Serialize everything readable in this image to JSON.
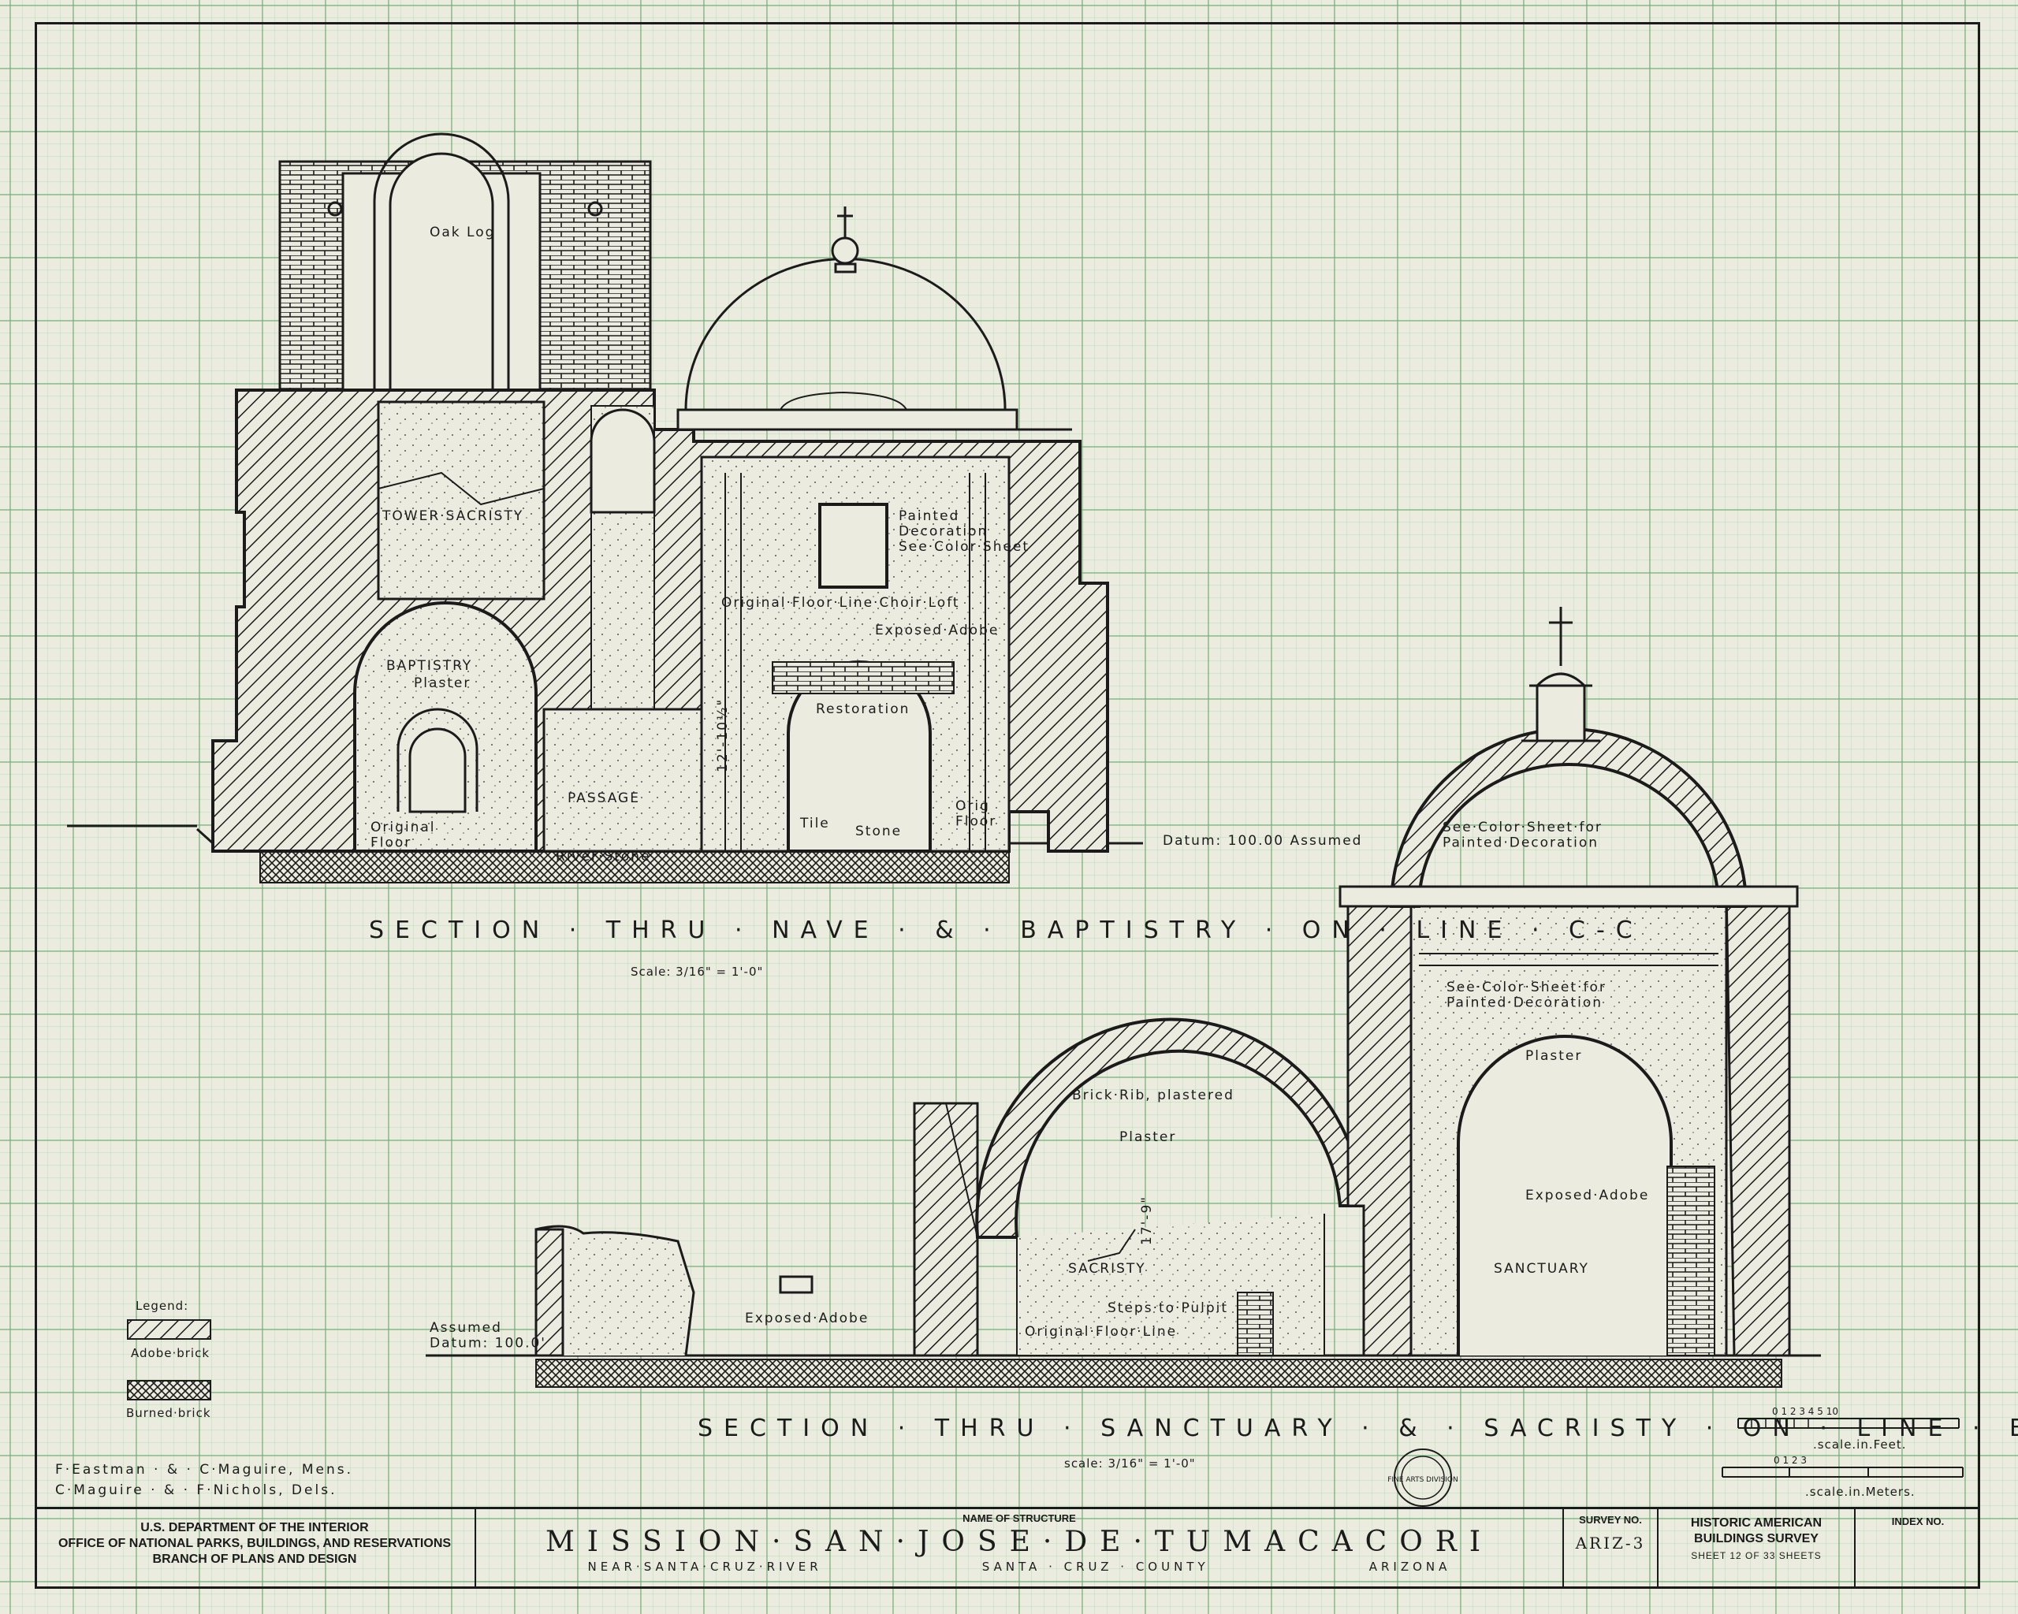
{
  "drawing": {
    "section_cc": {
      "title": "SECTION · THRU · NAVE · & · BAPTISTRY · ON · LINE · C-C",
      "scale": "Scale: 3/16\" = 1'-0\"",
      "labels": {
        "oak_log": "Oak Log",
        "tower_sacristy": "TOWER·SACRISTY",
        "painted_decoration": "Painted\nDecoration\nSee·Color·Sheet",
        "choir_loft": "Original·Floor·Line·Choir·Loft",
        "exposed_adobe": "Exposed·Adobe",
        "baptistry": "BAPTISTRY",
        "plaster": "Plaster",
        "restoration": "Restoration",
        "passage": "PASSAGE",
        "original_floor": "Original\nFloor",
        "dimension": "12'-10½\"",
        "tile": "Tile",
        "stone": "Stone",
        "orig_floor": "Orig\nFloor",
        "river_stone": "River·Stone",
        "datum": "Datum: 100.00 Assumed"
      }
    },
    "section_bb": {
      "title": "SECTION · THRU · SANCTUARY · & · SACRISTY · ON · LINE · B-B",
      "scale": "scale: 3/16\" = 1'-0\"",
      "labels": {
        "see_color_1": "See·Color·Sheet·for\nPainted·Decoration",
        "see_color_2": "See·Color·Sheet·for\nPainted·Decoration",
        "plaster_sanct": "Plaster",
        "brick_rib": "Brick·Rib, plastered",
        "plaster_sac": "Plaster",
        "dimension": "17'-9\"",
        "sacristy": "SACRISTY",
        "exposed_adobe_sanct": "Exposed·Adobe",
        "sanctuary": "SANCTUARY",
        "steps_to_pulpit": "Steps·to·Pulpit",
        "original_floor_line": "Original·Floor·Line",
        "exposed_adobe_left": "Exposed·Adobe",
        "assumed_datum": "Assumed\nDatum: 100.0'"
      }
    }
  },
  "legend": {
    "title": "Legend:",
    "items": [
      {
        "label": "Adobe·brick",
        "pattern": "hatch"
      },
      {
        "label": "Burned·brick",
        "pattern": "crosshatch"
      }
    ]
  },
  "scales": {
    "feet_ticks": [
      "0",
      "1",
      "2",
      "3",
      "4",
      "5",
      "10"
    ],
    "feet_label": ".scale.in.Feet.",
    "meters_ticks": [
      "0",
      "1",
      "2",
      "3"
    ],
    "meters_label": ".scale.in.Meters."
  },
  "stamp": "FINE ARTS DIVISION",
  "credits": [
    "F·Eastman · & · C·Maguire, Mens.",
    "C·Maguire · & · F·Nichols, Dels."
  ],
  "title_block": {
    "agency": [
      "U.S. DEPARTMENT OF THE INTERIOR",
      "OFFICE OF NATIONAL PARKS, BUILDINGS, AND RESERVATIONS",
      "BRANCH OF PLANS AND DESIGN"
    ],
    "name_caption": "NAME OF STRUCTURE",
    "structure_name": "MISSION·SAN·JOSE·DE·TUMACACORI",
    "location": [
      "NEAR·SANTA·CRUZ·RIVER",
      "SANTA · CRUZ · COUNTY",
      "ARIZONA"
    ],
    "survey_caption": "SURVEY NO.",
    "survey_no": "ARIZ-3",
    "habs": [
      "HISTORIC AMERICAN",
      "BUILDINGS SURVEY"
    ],
    "sheet": "SHEET 12 OF 33 SHEETS",
    "index_caption": "INDEX NO."
  }
}
